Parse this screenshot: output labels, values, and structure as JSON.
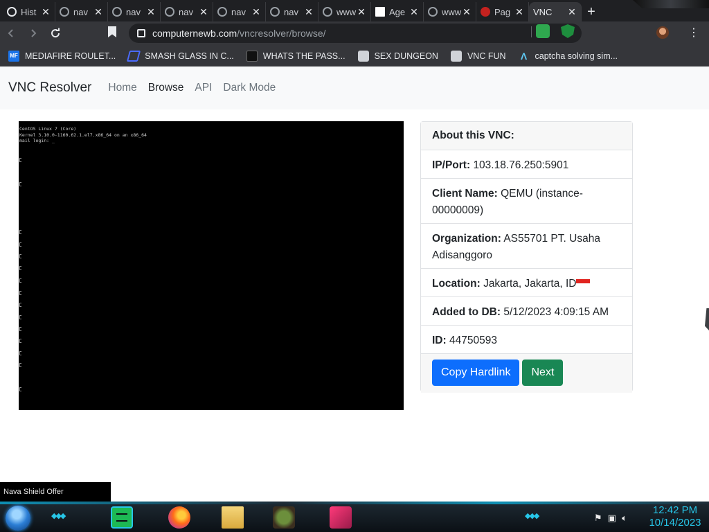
{
  "tabs": [
    {
      "title": "Hist",
      "icon": "history-icon"
    },
    {
      "title": "nav",
      "icon": "globe-icon"
    },
    {
      "title": "nav",
      "icon": "globe-icon"
    },
    {
      "title": "nav",
      "icon": "globe-icon"
    },
    {
      "title": "nav",
      "icon": "globe-icon"
    },
    {
      "title": "nav",
      "icon": "globe-icon"
    },
    {
      "title": "www",
      "icon": "globe-icon"
    },
    {
      "title": "Age",
      "icon": "blank-page-icon"
    },
    {
      "title": "www",
      "icon": "globe-icon"
    },
    {
      "title": "Pag",
      "icon": "ublock-icon"
    },
    {
      "title": "VNC",
      "icon": "vnc-icon"
    }
  ],
  "close_glyph": "✕",
  "new_tab_glyph": "+",
  "address": {
    "host": "computernewb.com",
    "path": "/vncresolver/browse/"
  },
  "bookmarks": [
    {
      "label": "MEDIAFIRE ROULET...",
      "icon": "mediafire-icon",
      "icon_text": "MF"
    },
    {
      "label": "SMASH GLASS IN C...",
      "icon": "smash-icon"
    },
    {
      "label": "WHATS THE PASS...",
      "icon": "dark-app-icon"
    },
    {
      "label": "SEX DUNGEON",
      "icon": "dice-icon"
    },
    {
      "label": "VNC FUN",
      "icon": "dice-icon"
    },
    {
      "label": "captcha solving sim...",
      "icon": "captcha-icon",
      "icon_text": "Λ"
    }
  ],
  "site": {
    "brand": "VNC Resolver",
    "nav": [
      "Home",
      "Browse",
      "API",
      "Dark Mode"
    ]
  },
  "vnc_screen": {
    "lines": [
      "CentOS Linux 7 (Core)",
      "Kernel 3.10.0-1160.62.1.el7.x86_64 on an x86_64",
      "",
      "mail login: _"
    ]
  },
  "card": {
    "header": "About this VNC:",
    "rows": [
      {
        "label": "IP/Port:",
        "value": "103.18.76.250:5901"
      },
      {
        "label": "Client Name:",
        "value": "QEMU (instance-00000009)"
      },
      {
        "label": "Organization:",
        "value": "AS55701 PT. Usaha Adisanggoro"
      },
      {
        "label": "Location:",
        "value": "Jakarta, Jakarta, ID"
      },
      {
        "label": "Added to DB:",
        "value": "5/12/2023 4:09:15 AM"
      },
      {
        "label": "ID:",
        "value": "44750593"
      }
    ],
    "buttons": {
      "copy": "Copy Hardlink",
      "next": "Next"
    },
    "colors": {
      "primary": "#0d6efd",
      "success": "#198754"
    }
  },
  "overlay_label": "Nava Shield Offer",
  "taskbar": {
    "time": "12:42 PM",
    "date": "10/14/2023"
  }
}
